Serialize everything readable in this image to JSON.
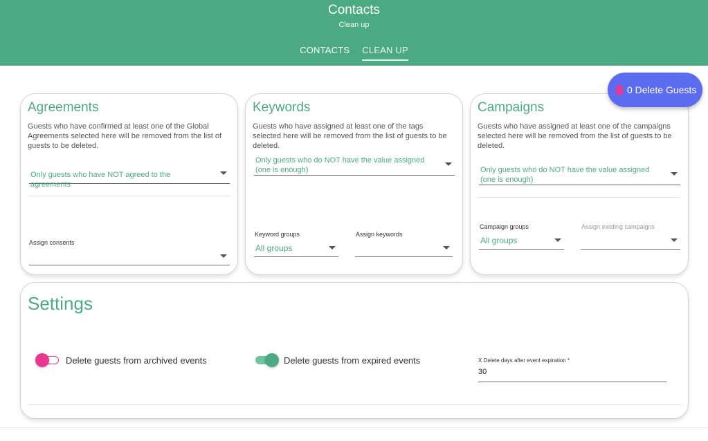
{
  "header": {
    "title": "Contacts",
    "subtitle": "Clean up",
    "tabs": [
      {
        "label": "CONTACTS",
        "active": false
      },
      {
        "label": "CLEAN UP",
        "active": true
      }
    ],
    "background_color": "#4caa82"
  },
  "fab": {
    "label": "0 Delete Guests",
    "icon": "trash-icon",
    "color": "#5b6cf0",
    "icon_color": "#e8388f"
  },
  "agreements": {
    "title": "Agreements",
    "description": "Guests who have confirmed at least one of the Global Agreements selected here will be removed from the list of guests to be deleted.",
    "filter_value": "Only guests who have NOT agreed to the agreements",
    "consents_label": "Assign consents",
    "consents_value": ""
  },
  "keywords": {
    "title": "Keywords",
    "description": "Guests who have assigned at least one of the tags selected here will be removed from the list of guests to be deleted.",
    "filter_value": "Only guests who do NOT have the value assigned (one is enough)",
    "groups_label": "Keyword groups",
    "groups_value": "All groups",
    "assign_label": "Assign keywords",
    "assign_value": ""
  },
  "campaigns": {
    "title": "Campaigns",
    "description": "Guests who have assigned at least one of the campaigns selected here will be removed from the list of guests to be deleted.",
    "filter_value": "Only guests who do NOT have the value assigned (one is enough)",
    "groups_label": "Campaign groups",
    "groups_value": "All groups",
    "assign_label": "Assign existing campaigns",
    "assign_value": ""
  },
  "settings": {
    "title": "Settings",
    "archived_label": "Delete guests from archived events",
    "archived_on": false,
    "expired_label": "Delete guests from expired events",
    "expired_on": true,
    "days_label": "X Delete days after event expiration *",
    "days_value": "30"
  },
  "colors": {
    "accent": "#4caa82",
    "toggle_pink": "#e8388f",
    "toggle_green": "#4caa82"
  }
}
